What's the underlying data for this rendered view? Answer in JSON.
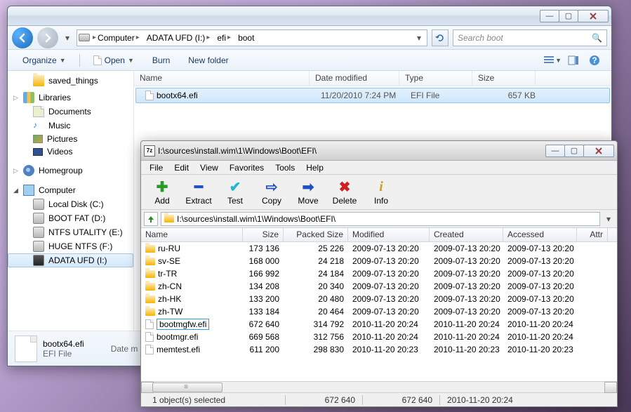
{
  "explorer": {
    "breadcrumbs": [
      "Computer",
      "ADATA UFD (I:)",
      "efi",
      "boot"
    ],
    "search_placeholder": "Search boot",
    "toolbar": {
      "organize": "Organize",
      "open": "Open",
      "burn": "Burn",
      "new_folder": "New folder"
    },
    "nav": {
      "saved_things": "saved_things",
      "libraries": "Libraries",
      "documents": "Documents",
      "music": "Music",
      "pictures": "Pictures",
      "videos": "Videos",
      "homegroup": "Homegroup",
      "computer": "Computer",
      "drives": [
        {
          "label": "Local Disk (C:)"
        },
        {
          "label": "BOOT FAT (D:)"
        },
        {
          "label": "NTFS UTALITY (E:)"
        },
        {
          "label": "HUGE NTFS (F:)"
        },
        {
          "label": "ADATA UFD (I:)"
        }
      ]
    },
    "columns": {
      "name": "Name",
      "date": "Date modified",
      "type": "Type",
      "size": "Size"
    },
    "files": [
      {
        "name": "bootx64.efi",
        "date": "11/20/2010 7:24 PM",
        "type": "EFI File",
        "size": "657 KB"
      }
    ],
    "details": {
      "name": "bootx64.efi",
      "type": "EFI File",
      "datem_label": "Date m"
    }
  },
  "sevenzip": {
    "title": "I:\\sources\\install.wim\\1\\Windows\\Boot\\EFI\\",
    "menu": [
      "File",
      "Edit",
      "View",
      "Favorites",
      "Tools",
      "Help"
    ],
    "toolbar": [
      {
        "label": "Add",
        "icon": "plus",
        "color": "#2a9a2a"
      },
      {
        "label": "Extract",
        "icon": "minus",
        "color": "#2050c0"
      },
      {
        "label": "Test",
        "icon": "check",
        "color": "#20b8d0"
      },
      {
        "label": "Copy",
        "icon": "copy",
        "color": "#2050c0"
      },
      {
        "label": "Move",
        "icon": "move",
        "color": "#2050c0"
      },
      {
        "label": "Delete",
        "icon": "x",
        "color": "#d02020"
      },
      {
        "label": "Info",
        "icon": "info",
        "color": "#d0a020"
      }
    ],
    "path": "I:\\sources\\install.wim\\1\\Windows\\Boot\\EFI\\",
    "columns": {
      "name": "Name",
      "size": "Size",
      "packed": "Packed Size",
      "modified": "Modified",
      "created": "Created",
      "accessed": "Accessed",
      "attr": "Attr"
    },
    "rows": [
      {
        "kind": "folder",
        "name": "ru-RU",
        "size": "173 136",
        "packed": "25 226",
        "modified": "2009-07-13 20:20",
        "created": "2009-07-13 20:20",
        "accessed": "2009-07-13 20:20"
      },
      {
        "kind": "folder",
        "name": "sv-SE",
        "size": "168 000",
        "packed": "24 218",
        "modified": "2009-07-13 20:20",
        "created": "2009-07-13 20:20",
        "accessed": "2009-07-13 20:20"
      },
      {
        "kind": "folder",
        "name": "tr-TR",
        "size": "166 992",
        "packed": "24 184",
        "modified": "2009-07-13 20:20",
        "created": "2009-07-13 20:20",
        "accessed": "2009-07-13 20:20"
      },
      {
        "kind": "folder",
        "name": "zh-CN",
        "size": "134 208",
        "packed": "20 340",
        "modified": "2009-07-13 20:20",
        "created": "2009-07-13 20:20",
        "accessed": "2009-07-13 20:20"
      },
      {
        "kind": "folder",
        "name": "zh-HK",
        "size": "133 200",
        "packed": "20 480",
        "modified": "2009-07-13 20:20",
        "created": "2009-07-13 20:20",
        "accessed": "2009-07-13 20:20"
      },
      {
        "kind": "folder",
        "name": "zh-TW",
        "size": "133 184",
        "packed": "20 464",
        "modified": "2009-07-13 20:20",
        "created": "2009-07-13 20:20",
        "accessed": "2009-07-13 20:20"
      },
      {
        "kind": "file",
        "name": "bootmgfw.efi",
        "size": "672 640",
        "packed": "314 792",
        "modified": "2010-11-20 20:24",
        "created": "2010-11-20 20:24",
        "accessed": "2010-11-20 20:24",
        "highlighted": true
      },
      {
        "kind": "file",
        "name": "bootmgr.efi",
        "size": "669 568",
        "packed": "312 756",
        "modified": "2010-11-20 20:24",
        "created": "2010-11-20 20:24",
        "accessed": "2010-11-20 20:24"
      },
      {
        "kind": "file",
        "name": "memtest.efi",
        "size": "611 200",
        "packed": "298 830",
        "modified": "2010-11-20 20:23",
        "created": "2010-11-20 20:23",
        "accessed": "2010-11-20 20:23"
      }
    ],
    "status": {
      "selected": "1 object(s) selected",
      "size1": "672 640",
      "size2": "672 640",
      "date": "2010-11-20 20:24"
    }
  }
}
